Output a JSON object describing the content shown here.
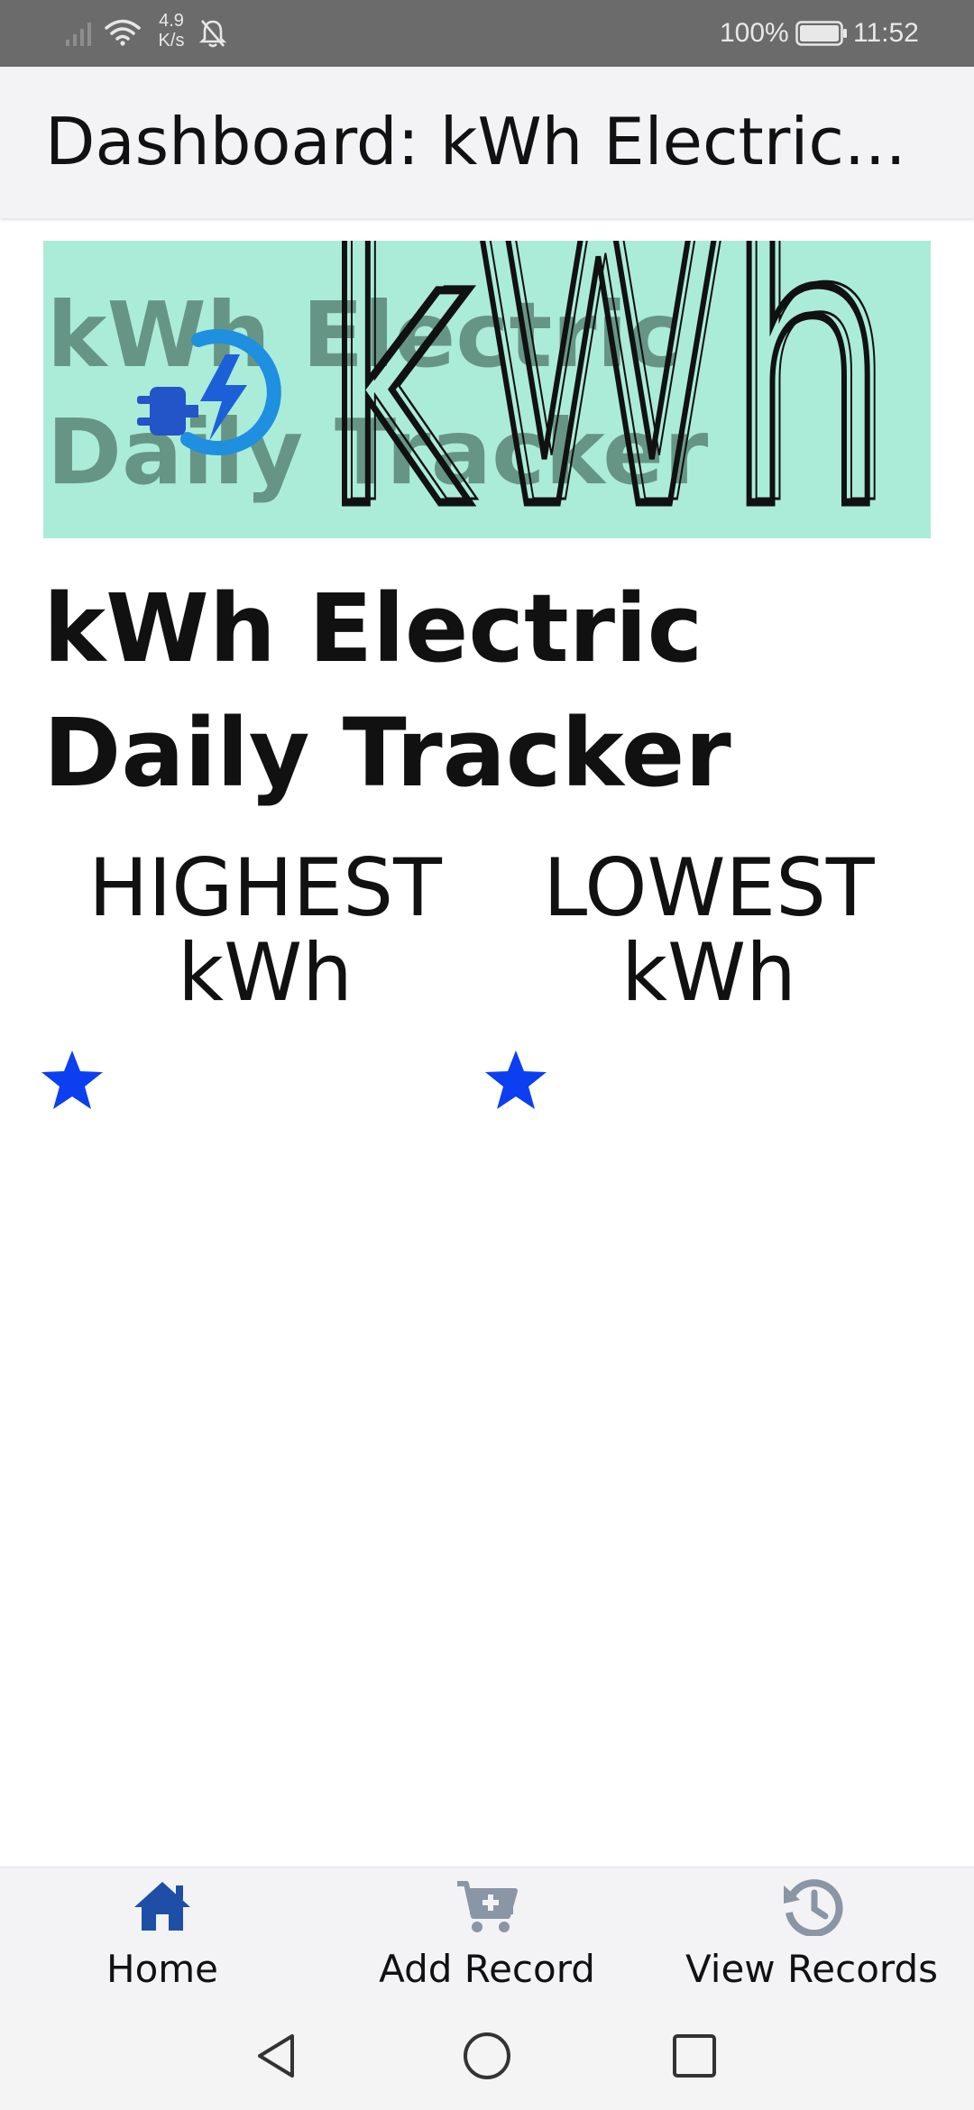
{
  "status_bar": {
    "network_speed": "4.9\nK/s",
    "battery_percent": "100%",
    "time": "11:52",
    "icons": [
      "signal-icon",
      "wifi-icon",
      "bell-off-icon",
      "battery-icon"
    ]
  },
  "toolbar": {
    "title": "Dashboard: kWh Electric..."
  },
  "banner": {
    "faded_text": "kWh Electric\nDaily Tracker",
    "logo_text": "kWh",
    "background": "#abecd8"
  },
  "main": {
    "heading": "kWh Electric Daily Tracker",
    "stats": {
      "highest": {
        "label": "HIGHEST\nkWh",
        "icon": "star-icon"
      },
      "lowest": {
        "label": "LOWEST\nkWh",
        "icon": "star-icon"
      }
    },
    "accent_color": "#0b3ff0"
  },
  "tab_bar": {
    "tabs": [
      {
        "label": "Home",
        "icon": "home-icon",
        "active": true,
        "color": "#1f4ea6"
      },
      {
        "label": "Add Record",
        "icon": "cart-plus-icon",
        "active": false,
        "color": "#8a95a6"
      },
      {
        "label": "View Records",
        "icon": "history-icon",
        "active": false,
        "color": "#8a95a6"
      }
    ]
  },
  "nav_bar": {
    "icons": [
      "back-icon",
      "home-circle-icon",
      "recents-icon"
    ]
  }
}
